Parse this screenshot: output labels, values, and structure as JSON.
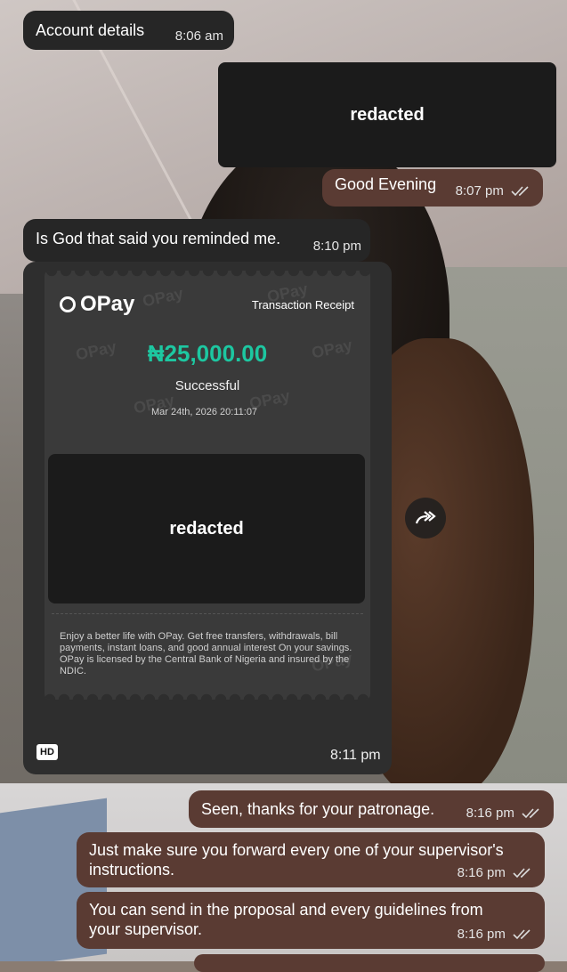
{
  "messages": [
    {
      "text": "Account details",
      "time": "8:06 am"
    },
    {
      "text": "redacted"
    },
    {
      "text": "Good Evening",
      "time": "8:07 pm"
    },
    {
      "text": "Is God that said you reminded me.",
      "time": "8:10 pm"
    },
    {
      "text": "Seen, thanks for your patronage.",
      "time": "8:16 pm"
    },
    {
      "text": "Just make sure you forward every one of your supervisor's instructions.",
      "time": "8:16 pm"
    },
    {
      "text": "You can send in the proposal and every guidelines from your supervisor.",
      "time": "8:16 pm"
    }
  ],
  "receipt": {
    "brand": "OPay",
    "title": "Transaction Receipt",
    "amount": "₦25,000.00",
    "status": "Successful",
    "datetime": "Mar 24th, 2026 20:11:07",
    "redacted": "redacted",
    "footer": "Enjoy a better life with OPay. Get free transfers, withdrawals, bill payments, instant loans, and good annual interest On your savings. OPay is licensed by the Central Bank of Nigeria and insured by the NDIC.",
    "watermark": "OPay",
    "hd_badge": "HD",
    "time": "8:11 pm"
  },
  "colors": {
    "incoming_bubble": "#262626",
    "outgoing_bubble": "#5a3b33",
    "amount_green": "#1dc7a1"
  },
  "icons": {
    "forward": "forward-icon",
    "read_ticks": "double-check-icon"
  }
}
